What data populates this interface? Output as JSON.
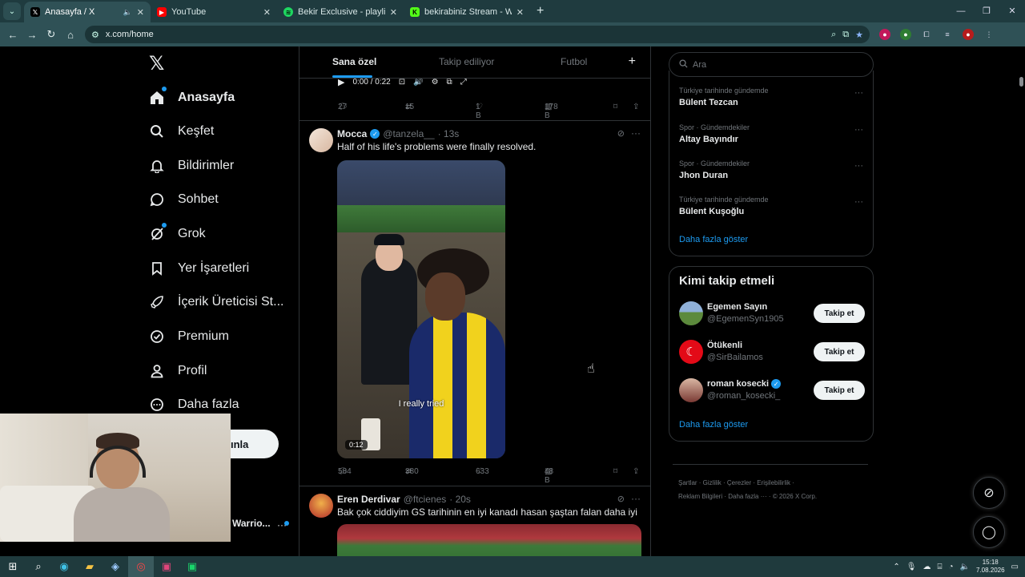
{
  "browser": {
    "tabs": [
      {
        "title": "Anasayfa / X",
        "favicon": "x-icon",
        "active": true,
        "audio": true
      },
      {
        "title": "YouTube",
        "favicon": "youtube-icon",
        "active": false
      },
      {
        "title": "Bekir Exclusive - playlist by Bekir",
        "favicon": "spotify-icon",
        "active": false
      },
      {
        "title": "bekirabiniz Stream - Watch Live",
        "favicon": "kick-icon",
        "active": false
      }
    ],
    "url": "x.com/home"
  },
  "leftnav": {
    "items": [
      {
        "label": "Anasayfa",
        "icon": "home-icon"
      },
      {
        "label": "Keşfet",
        "icon": "search-icon"
      },
      {
        "label": "Bildirimler",
        "icon": "bell-icon"
      },
      {
        "label": "Sohbet",
        "icon": "chat-icon"
      },
      {
        "label": "Grok",
        "icon": "grok-icon"
      },
      {
        "label": "Yer İşaretleri",
        "icon": "bookmark-icon"
      },
      {
        "label": "İçerik Üreticisi St...",
        "icon": "rocket-icon"
      },
      {
        "label": "Premium",
        "icon": "verified-icon"
      },
      {
        "label": "Profil",
        "icon": "person-icon"
      },
      {
        "label": "Daha fazla",
        "icon": "more-circle-icon"
      }
    ],
    "post_button_partial": "ınla",
    "account_name_partial": "Warrio...",
    "account_more": "···"
  },
  "feed": {
    "tabs": [
      "Sana özel",
      "Takip ediliyor",
      "Futbol"
    ],
    "plus": "+",
    "prev_video": {
      "time": "0:00 / 0:22"
    },
    "prev_actions": {
      "replies": "27",
      "reposts": "15",
      "likes": "1 B",
      "views": "178 B"
    },
    "tweet1": {
      "name": "Mocca",
      "handle": "@tanzela__",
      "time": "· 13s",
      "text": "Half of his life's problems were finally resolved.",
      "caption": "I really tried",
      "duration": "0:12",
      "actions": {
        "replies": "584",
        "reposts": "380",
        "likes": "633",
        "views": "48 B"
      }
    },
    "tweet2": {
      "name": "Eren Derdivar",
      "handle": "@ftcienes",
      "time": "· 20s",
      "text": "Bak çok ciddiyim GS tarihinin en iyi kanadı hasan şaştan falan daha iyi"
    }
  },
  "right": {
    "search_placeholder": "Ara",
    "trends": [
      {
        "category": "Türkiye tarihinde gündemde",
        "title": "Bülent Tezcan"
      },
      {
        "category": "Spor · Gündemdekiler",
        "title": "Altay Bayındır"
      },
      {
        "category": "Spor · Gündemdekiler",
        "title": "Jhon Duran"
      },
      {
        "category": "Türkiye tarihinde gündemde",
        "title": "Bülent Kuşoğlu"
      }
    ],
    "trends_more": "Daha fazla göster",
    "who_title": "Kimi takip etmeli",
    "who": [
      {
        "name": "Egemen Sayın",
        "handle": "@EgemenSyn1905",
        "verified": false,
        "follow": "Takip et"
      },
      {
        "name": "Ötükenli",
        "handle": "@SirBailamos",
        "verified": false,
        "follow": "Takip et"
      },
      {
        "name": "roman kosecki",
        "handle": "@roman_kosecki_",
        "verified": true,
        "follow": "Takip et"
      }
    ],
    "who_more": "Daha fazla göster",
    "footer": {
      "line1": [
        "Şartlar",
        "Gizlilik",
        "Çerezler",
        "Erişilebilirlik"
      ],
      "line2": [
        "Reklam Bilgileri",
        "Daha fazla ···",
        "© 2026 X Corp."
      ]
    }
  },
  "taskbar": {
    "time": "15:18",
    "date": "7.08.2026"
  },
  "colors": {
    "accent": "#1d9bf0",
    "chrome": "#1f3b3f",
    "bg": "#000000"
  }
}
